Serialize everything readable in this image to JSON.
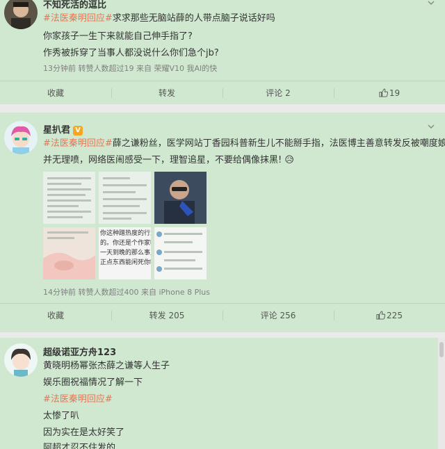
{
  "colors": {
    "card_bg": "#cfe8cf",
    "tag": "#eb7350",
    "meta": "#808080",
    "badge": "#f5a623"
  },
  "posts": [
    {
      "username": "不知死活的逗比",
      "lines": [
        {
          "tag": "#法医秦明回应#",
          "text": "求求那些无脑站薛的人带点脑子说话好吗"
        },
        {
          "tag": "",
          "text": "你家孩子一生下来就能自己伸手指了?"
        },
        {
          "tag": "",
          "text": "作秀被拆穿了当事人都没说什么你们急个jb?"
        }
      ],
      "meta": "13分钟前  转赞人数超过19  来自  荣耀V10 我AI的快",
      "actions": {
        "favorite": "收藏",
        "repost": "转发",
        "comment": "评论 2",
        "like": "19"
      }
    },
    {
      "username": "星扒君",
      "badge": "V",
      "lines": [
        {
          "tag": "#法医秦明回应#",
          "text": "薛之谦粉丝，医学网站丁香园科普新生儿不能掰手指，法医博主善意转发反被嘲度娘"
        },
        {
          "tag": "",
          "text": "并无理喷，网络医闹感受一下，理智追星，不要给偶像抹黑! 😥"
        }
      ],
      "thumbnail_texts": {
        "t5_lines": [
          "你这种蹭热度的行为真是",
          "的。你还是个作家吗?你",
          "一天到晚的那么事儿?你",
          "正点东西能闲死你吗"
        ]
      },
      "meta": "14分钟前  转赞人数超过400  来自  iPhone 8 Plus",
      "actions": {
        "favorite": "收藏",
        "repost": "转发 205",
        "comment": "评论 256",
        "like": "225"
      }
    },
    {
      "username": "超级诺亚方舟123",
      "lines": [
        {
          "tag": "",
          "text": "黄晓明杨幂张杰薛之谦等人生子"
        },
        {
          "tag": "",
          "text": "娱乐圈祝福情况了解一下"
        },
        {
          "tag": "#法医秦明回应#",
          "text": ""
        },
        {
          "tag": "",
          "text": "太惨了叭"
        },
        {
          "tag": "",
          "text": "因为实在是太好笑了"
        },
        {
          "tag": "",
          "text": "阿超才忍不住发的"
        }
      ]
    }
  ]
}
